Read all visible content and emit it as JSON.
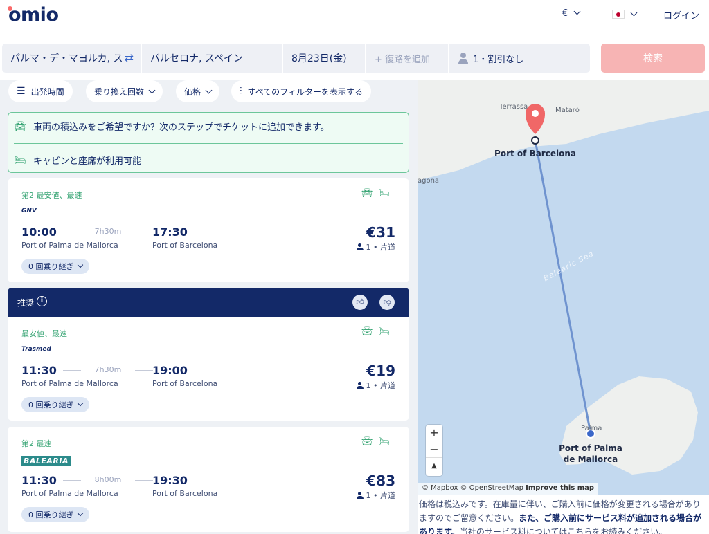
{
  "header": {
    "logo": "omio",
    "currency": "€",
    "login": "ログイン"
  },
  "search": {
    "origin": "パルマ・デ・マヨルカ, ス",
    "destination": "バルセロナ, スペイン",
    "date": "8月23日(金)",
    "return_placeholder": "+ 復路を追加",
    "passengers": "1・割引なし",
    "search_button": "検索"
  },
  "filters": [
    {
      "label": "出発時間"
    },
    {
      "label": "乗り換え回数"
    },
    {
      "label": "価格"
    },
    {
      "label": "すべてのフィルターを表示する"
    }
  ],
  "notice": {
    "vehicle": "車両の積込みをご希望ですか？次のステップでチケットに追加できます。",
    "cabin": "キャビンと座席が利用可能"
  },
  "recommend": {
    "label": "推奨"
  },
  "results": [
    {
      "tag": "第2 最安値、最速",
      "operator": "GNV",
      "depart": "10:00",
      "duration": "7h30m",
      "arrive": "17:30",
      "from": "Port of Palma de Mallorca",
      "to": "Port of Barcelona",
      "price": "€31",
      "pax": "1 • 片道",
      "transfers": "0 回乗り継ぎ"
    },
    {
      "tag": "最安値、最速",
      "operator": "Trasmed",
      "depart": "11:30",
      "duration": "7h30m",
      "arrive": "19:00",
      "from": "Port of Palma de Mallorca",
      "to": "Port of Barcelona",
      "price": "€19",
      "pax": "1 • 片道",
      "transfers": "0 回乗り継ぎ"
    },
    {
      "tag": "第2 最速",
      "operator": "BALEARIA",
      "depart": "11:30",
      "duration": "8h00m",
      "arrive": "19:30",
      "from": "Port of Palma de Mallorca",
      "to": "Port of Barcelona",
      "price": "€83",
      "pax": "1 • 片道",
      "transfers": "0 回乗り継ぎ"
    }
  ],
  "map": {
    "labels": {
      "terrassa": "Terrassa",
      "mataro": "Mataró",
      "tarragona": "agona",
      "sea": "Balearic Sea",
      "palma": "Palma"
    },
    "port_barcelona": "Port of Barcelona",
    "port_palma_1": "Port of Palma",
    "port_palma_2": "de Mallorca",
    "zoom_in": "+",
    "zoom_out": "−",
    "compass": "▲",
    "attribution": "© Mapbox © OpenStreetMap",
    "improve": "Improve this map"
  },
  "disclaimer": {
    "text1": "価格は税込みです。在庫量に伴い、ご購入前に価格が変更される場合がありますのでご留意ください。",
    "bold": "また、ご購入前にサービス料が追加される場合があります。",
    "link": "当社のサービス料についてはこちらをお読みください。"
  },
  "colors": {
    "brand_navy": "#132968",
    "brand_coral": "#fa6b6b",
    "search_disabled": "#f7b4b4",
    "green": "#3aa676",
    "sea": "#c3d9ef"
  }
}
